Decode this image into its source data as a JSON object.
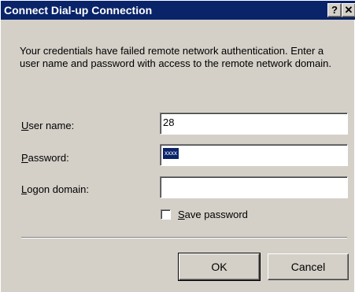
{
  "window": {
    "title": "Connect Dial-up Connection",
    "help_label": "?",
    "close_label": "✕"
  },
  "message": "Your credentials have failed remote network authentication. Enter a user name and password with access to the remote network domain.",
  "form": {
    "username": {
      "label_accel": "U",
      "label_rest": "ser name:",
      "value": "28"
    },
    "password": {
      "label_accel": "P",
      "label_rest": "assword:",
      "value": "xxxx"
    },
    "domain": {
      "label_accel": "L",
      "label_rest": "ogon domain:",
      "value": ""
    },
    "save_password": {
      "label_accel": "S",
      "label_rest": "ave password",
      "checked": false
    }
  },
  "buttons": {
    "ok": "OK",
    "cancel": "Cancel"
  },
  "colors": {
    "titlebar": "#0a246a",
    "face": "#d4d0c8",
    "selection": "#0a246a"
  }
}
